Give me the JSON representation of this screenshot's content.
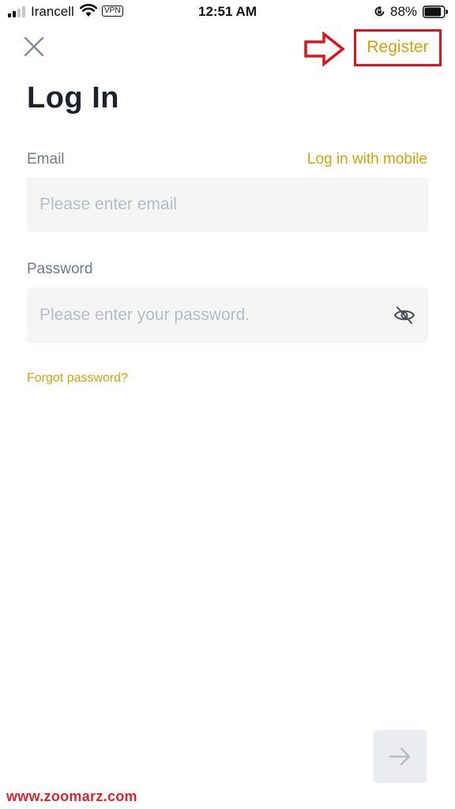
{
  "status_bar": {
    "carrier": "Irancell",
    "vpn_label": "VPN",
    "time": "12:51 AM",
    "battery_percent": "88%",
    "battery_level": 0.88
  },
  "header": {
    "register_label": "Register"
  },
  "title": "Log In",
  "email": {
    "label": "Email",
    "alt_link": "Log in with mobile",
    "placeholder": "Please enter email",
    "value": ""
  },
  "password": {
    "label": "Password",
    "placeholder": "Please enter your password.",
    "value": ""
  },
  "forgot_label": "Forgot password?",
  "watermark": "www.zoomarz.com",
  "colors": {
    "accent": "#d4a20c",
    "annotation": "#e1121f",
    "input_bg": "#f5f5f5",
    "label": "#707a8a"
  },
  "icons": {
    "close": "close-icon",
    "eye": "eye-off-icon",
    "next": "arrow-right-icon"
  }
}
